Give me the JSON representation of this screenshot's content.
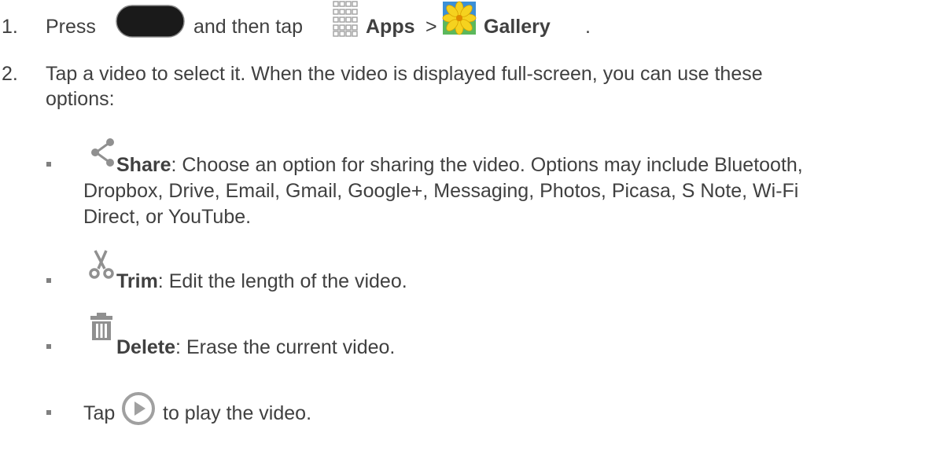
{
  "step1": {
    "number": "1.",
    "press": "Press",
    "then_tap": "and then tap",
    "apps_label": "Apps",
    "separator": ">",
    "gallery_label": "Gallery",
    "end": "."
  },
  "step2": {
    "number": "2.",
    "text_line1": "Tap a video to select it. When the video is displayed full-screen, you can use these",
    "text_line2": "options:"
  },
  "options": {
    "share": {
      "label": "Share",
      "line1": ": Choose an option for sharing the video. Options may include Bluetooth,",
      "line2": "Dropbox, Drive, Email, Gmail, Google+, Messaging, Photos, Picasa, S Note, Wi-Fi",
      "line3": "Direct, or YouTube."
    },
    "trim": {
      "label": "Trim",
      "desc": ": Edit the length of the video."
    },
    "delete": {
      "label": "Delete",
      "desc": ": Erase the current video."
    },
    "play": {
      "tap": "Tap",
      "desc": "to play the video."
    }
  },
  "icons": {
    "home_button": "home-button-icon",
    "apps": "apps-grid-icon",
    "gallery": "gallery-icon",
    "share": "share-icon",
    "trim": "scissors-icon",
    "delete": "trash-icon",
    "play": "play-icon"
  },
  "colors": {
    "text": "#404040",
    "bullet": "#808080",
    "icon_gray": "#909090"
  }
}
